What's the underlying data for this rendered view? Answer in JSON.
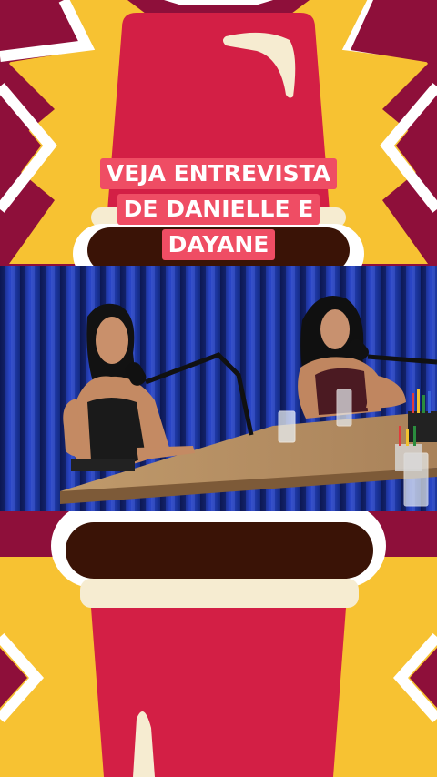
{
  "caption": {
    "lines": [
      "VEJA ENTREVISTA",
      "DE DANIELLE E",
      "DAYANE"
    ]
  },
  "colors": {
    "burgundy": "#8e0f3a",
    "yellow": "#f7c232",
    "red": "#d31f45",
    "cream": "#f6ecd1",
    "brown": "#3a1306",
    "caption_bg": "#ef4d64",
    "curtain_blue": "#1a2f8c"
  },
  "scene": {
    "description_icons": [
      "microphone-icon",
      "water-glass-icon",
      "pen-cup-icon"
    ]
  }
}
